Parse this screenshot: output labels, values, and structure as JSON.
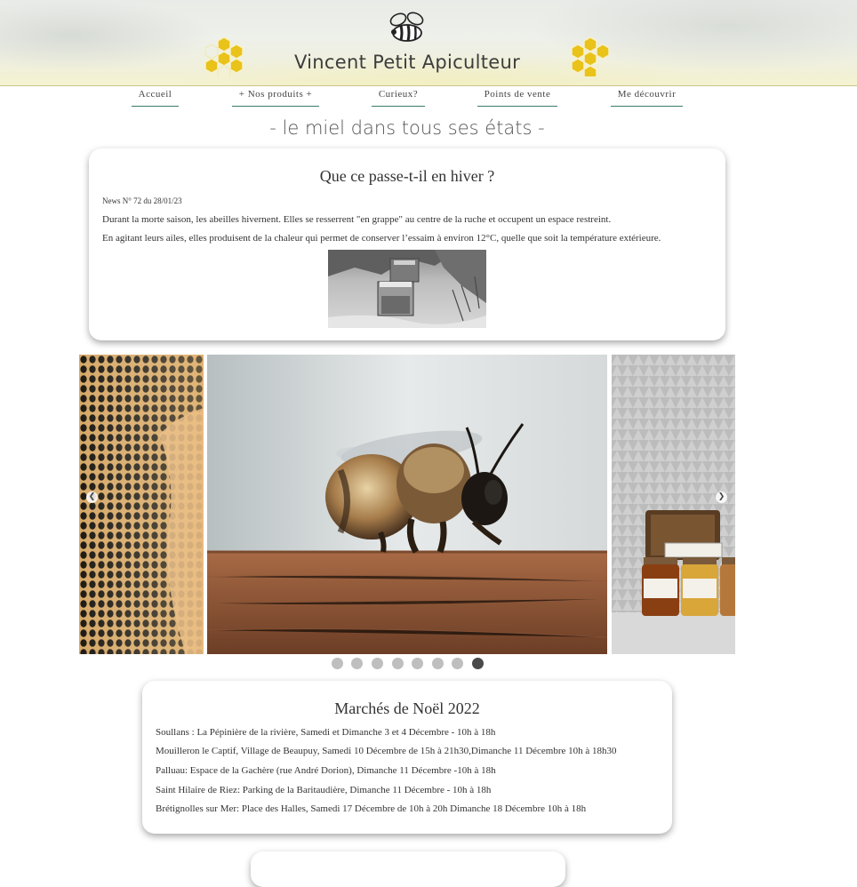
{
  "header": {
    "site_title": "Vincent Petit Apiculteur",
    "tagline": "- le miel dans tous ses états -"
  },
  "nav": {
    "items": [
      {
        "label": "Accueil"
      },
      {
        "label": "+ Nos produits +"
      },
      {
        "label": "Curieux?"
      },
      {
        "label": "Points de vente"
      },
      {
        "label": "Me découvrir"
      }
    ]
  },
  "news": {
    "title": "Que ce passe-t-il en hiver ?",
    "meta": "News N° 72 du 28/01/23",
    "line1": "Durant la morte saison, les abeilles hivernent. Elles se resserrent \"en grappe\" au centre de la ruche et occupent un espace restreint.",
    "line2": "En agitant leurs ailes, elles produisent de la chaleur qui permet de conserver l’essaim à environ 12°C, quelle que soit la température extérieure."
  },
  "carousel": {
    "prev_icon": "chevron-left-icon",
    "next_icon": "chevron-right-icon",
    "dot_count": 8,
    "active_dot": 8
  },
  "markets": {
    "title": "Marchés de Noël 2022",
    "lines": [
      "Soullans : La Pépinière de la rivière, Samedi et Dimanche 3 et 4 Décembre - 10h à 18h",
      "Mouilleron le Captif, Village de Beaupuy, Samedi 10 Décembre de 15h à 21h30,Dimanche 11 Décembre 10h à 18h30",
      "Palluau: Espace de la Gachère (rue André Dorion), Dimanche 11 Décembre -10h à 18h",
      "Saint Hilaire de Riez: Parking de la Baritaudière, Dimanche 11 Décembre - 10h à 18h",
      "Brétignolles sur Mer: Place des Halles, Samedi 17 Décembre de 10h à 20h Dimanche 18 Décembre 10h à 18h"
    ]
  },
  "colors": {
    "accent": "#3a7a6a",
    "honey": "#e9c21a",
    "dot_active": "#4a4a4a",
    "dot_inactive": "#bfbfbf"
  }
}
